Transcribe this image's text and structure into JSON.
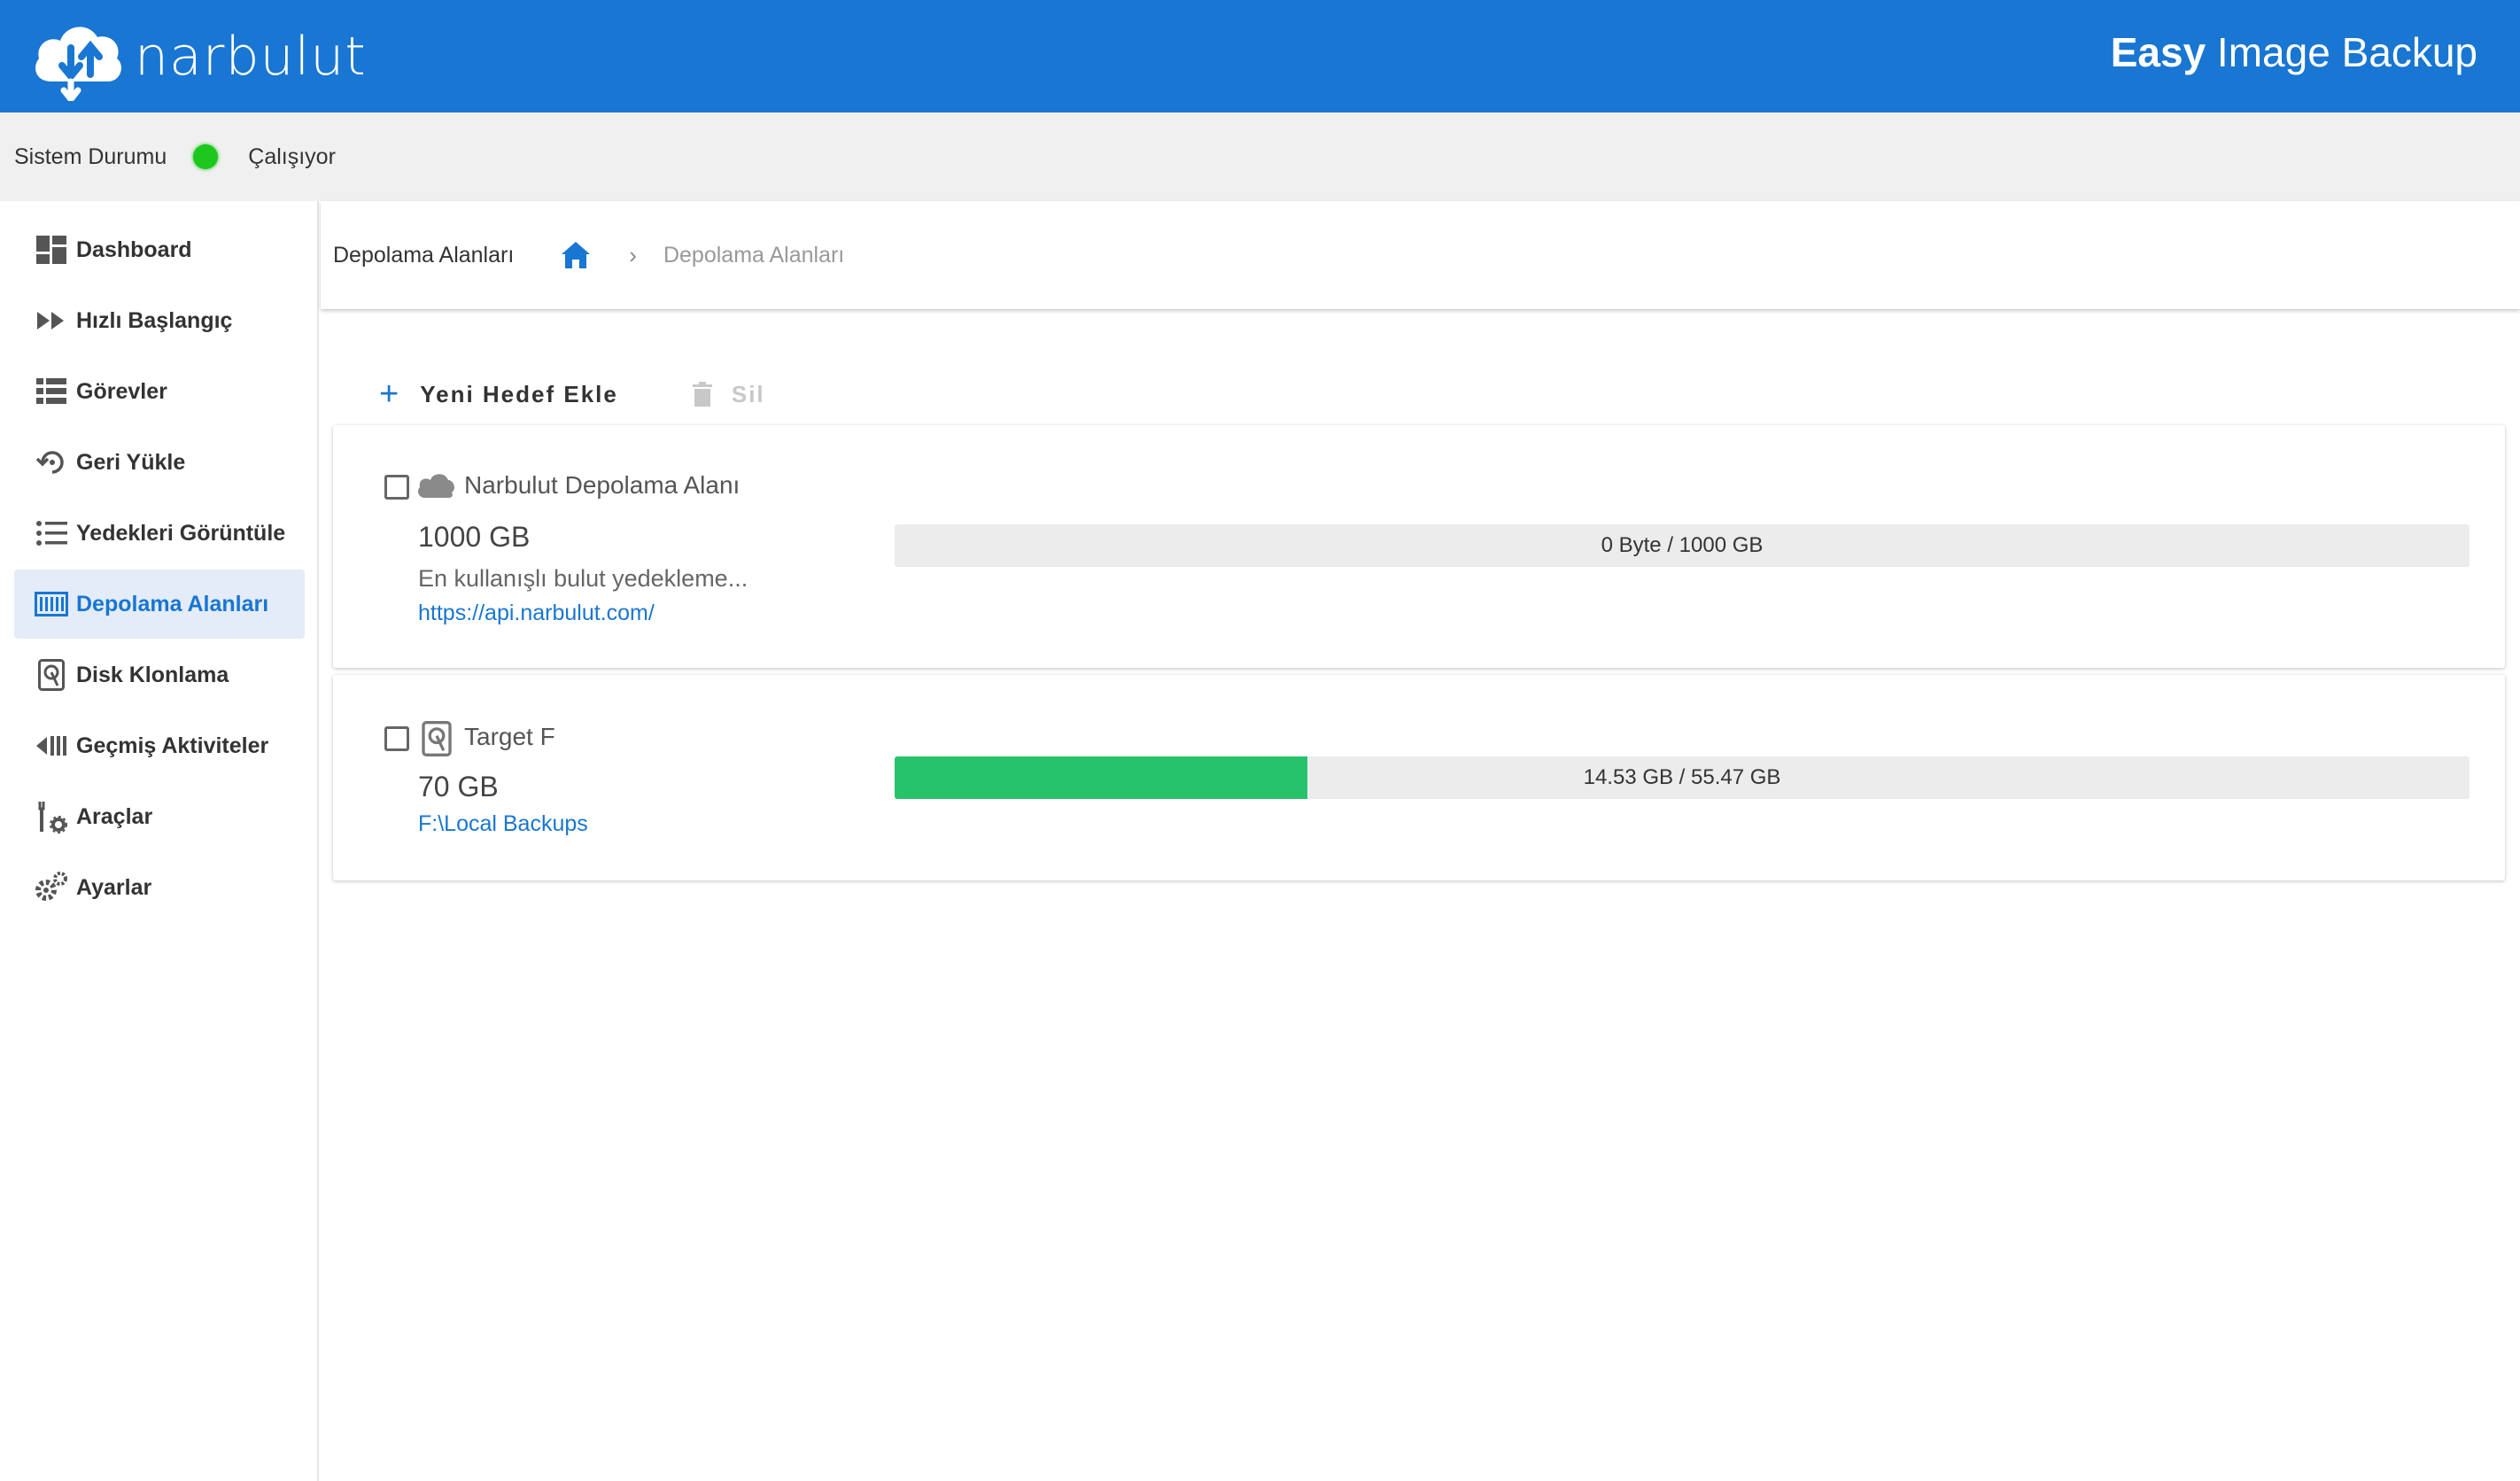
{
  "header": {
    "logo_text": "narbulut",
    "app_title_bold": "Easy",
    "app_title_rest": " Image Backup"
  },
  "status": {
    "label": "Sistem Durumu",
    "value": "Çalışıyor",
    "color": "#1ec71e"
  },
  "sidebar": {
    "items": [
      {
        "label": "Dashboard",
        "icon": "dashboard-icon"
      },
      {
        "label": "Hızlı Başlangıç",
        "icon": "fast-forward-icon"
      },
      {
        "label": "Görevler",
        "icon": "task-list-icon"
      },
      {
        "label": "Geri Yükle",
        "icon": "restore-icon"
      },
      {
        "label": "Yedekleri Görüntüle",
        "icon": "list-icon"
      },
      {
        "label": "Depolama Alanları",
        "icon": "storage-icon",
        "active": true
      },
      {
        "label": "Disk Klonlama",
        "icon": "disk-icon"
      },
      {
        "label": "Geçmiş Aktiviteler",
        "icon": "history-icon"
      },
      {
        "label": "Araçlar",
        "icon": "tools-icon"
      },
      {
        "label": "Ayarlar",
        "icon": "settings-icon"
      }
    ]
  },
  "breadcrumb": {
    "title": "Depolama Alanları",
    "separator": "›",
    "current": "Depolama Alanları"
  },
  "toolbar": {
    "add_label": "Yeni Hedef Ekle",
    "delete_label": "Sil"
  },
  "targets": [
    {
      "name": "Narbulut Depolama Alanı",
      "size": "1000 GB",
      "description": "En kullanışlı bulut yedekleme...",
      "link": "https://api.narbulut.com/",
      "usage_label": "0 Byte / 1000 GB",
      "usage_fraction": 0
    },
    {
      "name": "Target F",
      "size": "70 GB",
      "link": "F:\\Local Backups",
      "usage_label": "14.53 GB / 55.47 GB",
      "usage_fraction": 0.262
    }
  ],
  "colors": {
    "brand": "#1976d2",
    "progress": "#27c36b"
  }
}
